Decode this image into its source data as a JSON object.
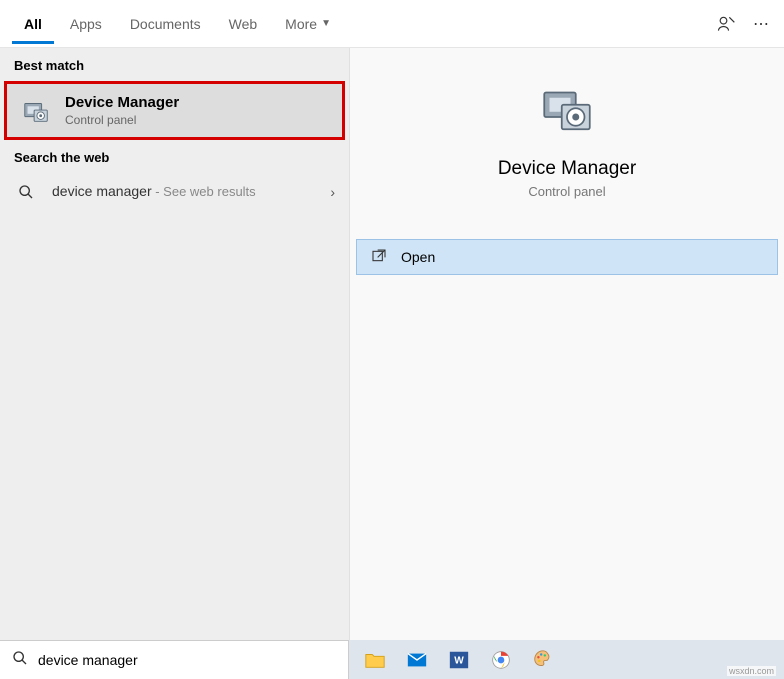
{
  "tabs": {
    "all": "All",
    "apps": "Apps",
    "documents": "Documents",
    "web": "Web",
    "more": "More"
  },
  "left": {
    "best_match": "Best match",
    "result": {
      "title": "Device Manager",
      "sub": "Control panel"
    },
    "search_web": "Search the web",
    "web": {
      "query": "device manager",
      "hint": " - See web results"
    }
  },
  "preview": {
    "title": "Device Manager",
    "sub": "Control panel",
    "open": "Open"
  },
  "search": {
    "value": "device manager"
  },
  "watermark": "wsxdn.com"
}
